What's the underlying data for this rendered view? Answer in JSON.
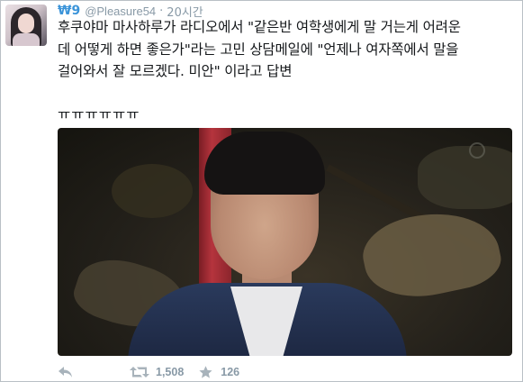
{
  "user": {
    "display_name": "₩9",
    "handle": "@Pleasure54",
    "separator": "·",
    "timestamp": "20시간"
  },
  "tweet": {
    "text": "후쿠야마 마사하루가 라디오에서 \"같은반 여학생에게 말 거는게 어려운\n데 어떻게 하면 좋은가\"라는 고민 상담메일에 \"언제나 여자쪽에서 말을\n걸어와서 잘 모르겠다. 미안\" 이라고 답변",
    "suffix": "ㅠㅠㅠㅠㅠㅠ"
  },
  "actions": {
    "retweet_count": "1,508",
    "favorite_count": "126"
  },
  "colors": {
    "name_blue": "#3b94d9",
    "meta_gray": "#8899a6",
    "icon_gray": "#a8b3bb"
  },
  "icons": {
    "reply": "reply-icon",
    "retweet": "retweet-icon",
    "favorite": "star-icon"
  }
}
